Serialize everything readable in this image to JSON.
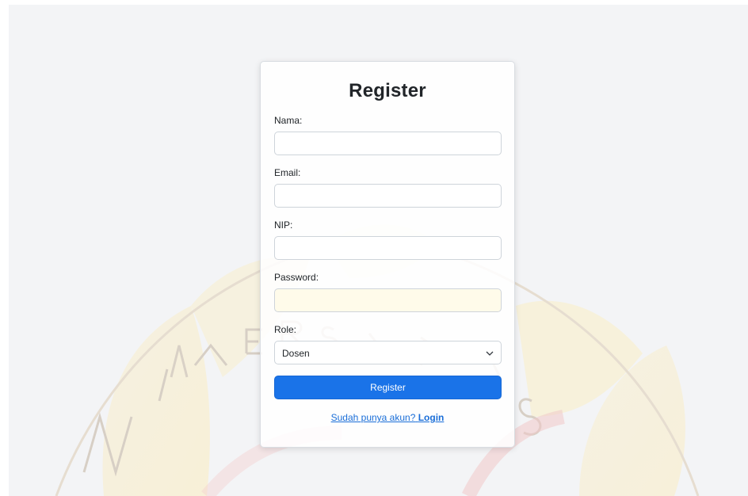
{
  "form": {
    "title": "Register",
    "fields": {
      "nama": {
        "label": "Nama:",
        "value": ""
      },
      "email": {
        "label": "Email:",
        "value": ""
      },
      "nip": {
        "label": "NIP:",
        "value": ""
      },
      "password": {
        "label": "Password:",
        "value": ""
      },
      "role": {
        "label": "Role:",
        "value": "Dosen"
      }
    },
    "submit_label": "Register",
    "login_prompt": "Sudah punya akun?",
    "login_label": "Login"
  },
  "watermark": {
    "text_letters": [
      "N",
      "I",
      "V",
      "E",
      "R",
      "S",
      "I",
      "T",
      "A",
      "S"
    ]
  },
  "colors": {
    "primary": "#1a73e8",
    "link": "#1a6ed8",
    "background": "#f3f4f6"
  }
}
